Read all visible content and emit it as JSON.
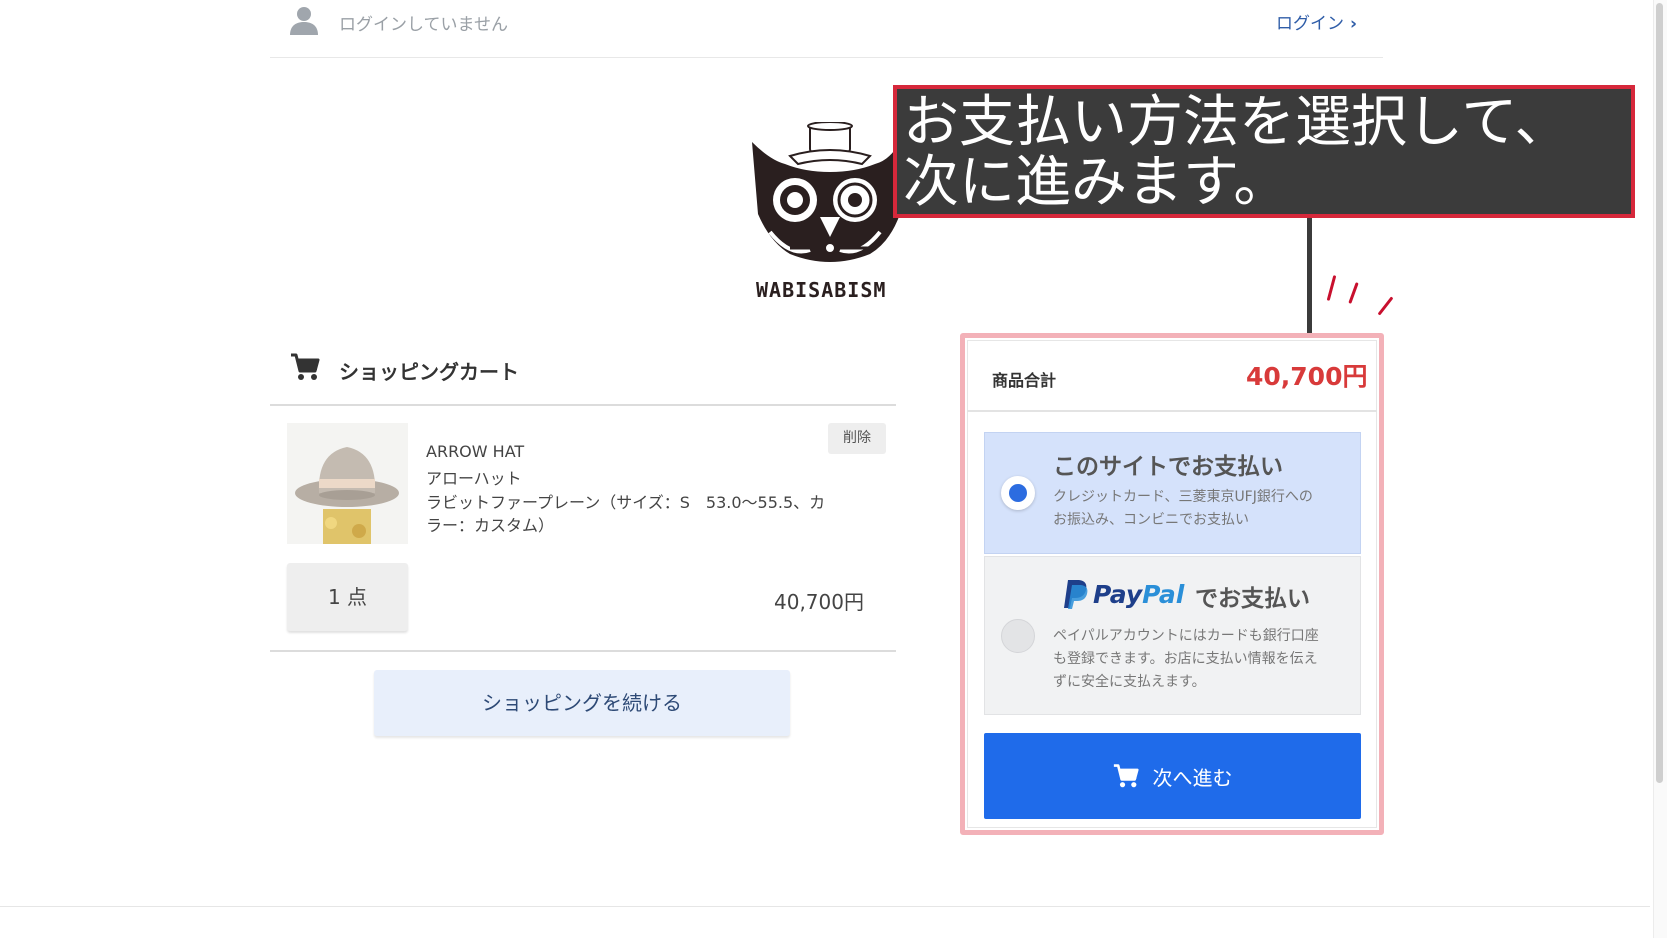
{
  "header": {
    "login_status": "ログインしていません",
    "login_link": "ログイン",
    "login_chevron": "›"
  },
  "logo": {
    "brand": "WABISABISM"
  },
  "annotation": {
    "line1": "お支払い方法を選択して、",
    "line2": "次に進みます。",
    "border_color": "#d6283b",
    "background": "#3b3b3b"
  },
  "cart": {
    "title": "ショッピングカート",
    "item": {
      "name_en": "ARROW HAT",
      "name_ja": "アローハット",
      "variant_line1": "ラビットファープレーン（サイズ：S　53.0〜55.5、カ",
      "variant_line2": "ラー：カスタム）",
      "delete_label": "削除",
      "quantity": "1 点",
      "price": "40,700円"
    },
    "continue_label": "ショッピングを続ける"
  },
  "summary": {
    "subtotal_label": "商品合計",
    "subtotal_value": "40,700円",
    "payment_options": [
      {
        "title": "このサイトでお支払い",
        "desc_line1": "クレジットカード、三菱東京UFJ銀行への",
        "desc_line2": "お振込み、コンビニでお支払い",
        "selected": true
      },
      {
        "brand_pay": "Pay",
        "brand_pal": "Pal",
        "title_suffix": "でお支払い",
        "desc_line1": "ペイパルアカウントにはカードも銀行口座",
        "desc_line2": "も登録できます。お店に支払い情報を伝え",
        "desc_line3": "ずに安全に支払えます。",
        "selected": false
      }
    ],
    "next_label": "次へ進む"
  },
  "colors": {
    "accent_blue": "#1f6bea",
    "price_red": "#d83a3a",
    "selected_option_bg": "#d5e2fb",
    "highlight_outline": "#f3b1b8"
  },
  "icons": [
    "user-icon",
    "chevron-right-icon",
    "cart-icon",
    "paypal-icon",
    "radio-selected-icon",
    "radio-unselected-icon"
  ]
}
